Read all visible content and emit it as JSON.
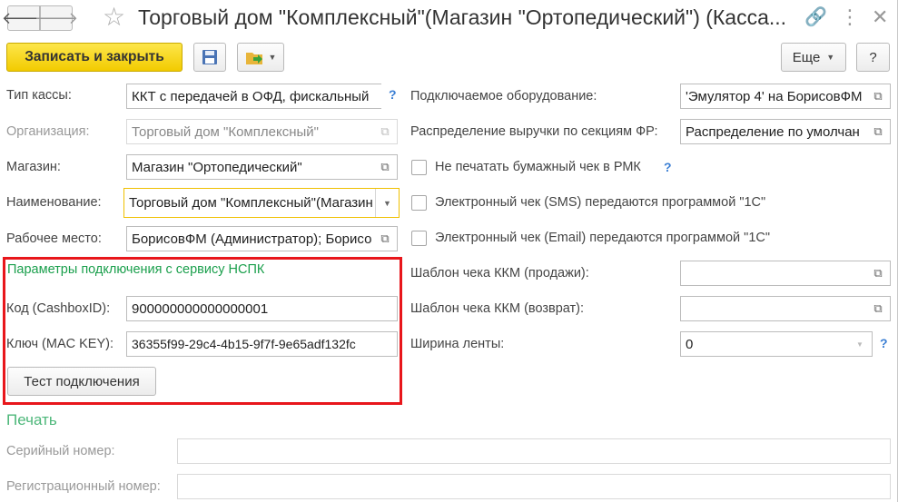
{
  "window": {
    "title": "Торговый дом \"Комплексный\"(Магазин \"Ортопедический\") (Касса..."
  },
  "toolbar": {
    "save_close_label": "Записать и закрыть",
    "more_label": "Еще",
    "help_label": "?"
  },
  "form": {
    "kassa_type": {
      "label": "Тип кассы:",
      "value": "ККТ с передачей в ОФД, фискальный"
    },
    "organization": {
      "label": "Организация:",
      "value": "Торговый дом \"Комплексный\""
    },
    "store": {
      "label": "Магазин:",
      "value": "Магазин \"Ортопедический\""
    },
    "name": {
      "label": "Наименование:",
      "value": "Торговый дом \"Комплексный\"(Магазин"
    },
    "workplace": {
      "label": "Рабочее место:",
      "value": "БорисовФМ (Администратор); Борисо"
    },
    "equipment": {
      "label": "Подключаемое оборудование:",
      "value": "'Эмулятор 4' на БорисовФМ"
    },
    "distribution": {
      "label": "Распределение выручки по секциям ФР:",
      "value": "Распределение по умолчан"
    },
    "no_paper": {
      "label": "Не печатать бумажный чек в РМК"
    },
    "sms": {
      "label": "Электронный чек (SMS) передаются программой \"1С\""
    },
    "email": {
      "label": "Электронный чек (Email) передаются программой \"1С\""
    },
    "template_sale": {
      "label": "Шаблон чека ККМ (продажи):",
      "value": ""
    },
    "template_return": {
      "label": "Шаблон чека ККМ (возврат):",
      "value": ""
    },
    "tape_width": {
      "label": "Ширина ленты:",
      "value": "0"
    }
  },
  "nspk": {
    "header": "Параметры подключения с сервису НСПК",
    "cashbox_label": "Код (CashboxID):",
    "cashbox_value": "900000000000000001",
    "key_label": "Ключ (MAC KEY):",
    "key_value": "36355f99-29c4-4b15-9f7f-9e65adf132fc",
    "test_button": "Тест подключения"
  },
  "print": {
    "header": "Печать",
    "serial_label": "Серийный номер:",
    "serial_value": "",
    "reg_label": "Регистрационный номер:",
    "reg_value": ""
  },
  "help_mark": "?"
}
